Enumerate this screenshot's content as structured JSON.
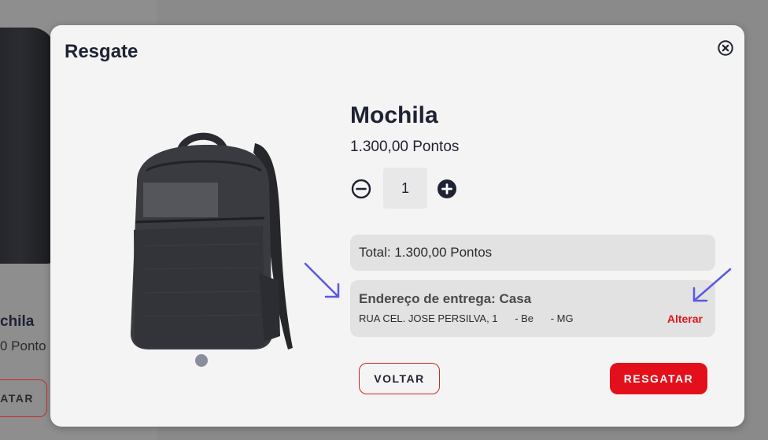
{
  "background": {
    "product_title": "chila",
    "product_points": "0 Ponto",
    "button_label": "ATAR"
  },
  "modal": {
    "title": "Resgate",
    "close_icon": "close-circle-icon"
  },
  "product": {
    "name": "Mochila",
    "price": "1.300,00 Pontos",
    "quantity": "1"
  },
  "summary": {
    "total": "Total: 1.300,00 Pontos"
  },
  "address": {
    "title": "Endereço de entrega: Casa",
    "line": "RUA CEL. JOSE PERSILVA, 1      - Be      - MG",
    "change_label": "Alterar"
  },
  "actions": {
    "back_label": "VOLTAR",
    "redeem_label": "RESGATAR"
  },
  "colors": {
    "accent_red": "#e3101b",
    "dark_navy": "#1f2233",
    "annotation_arrow": "#5b57e6"
  }
}
